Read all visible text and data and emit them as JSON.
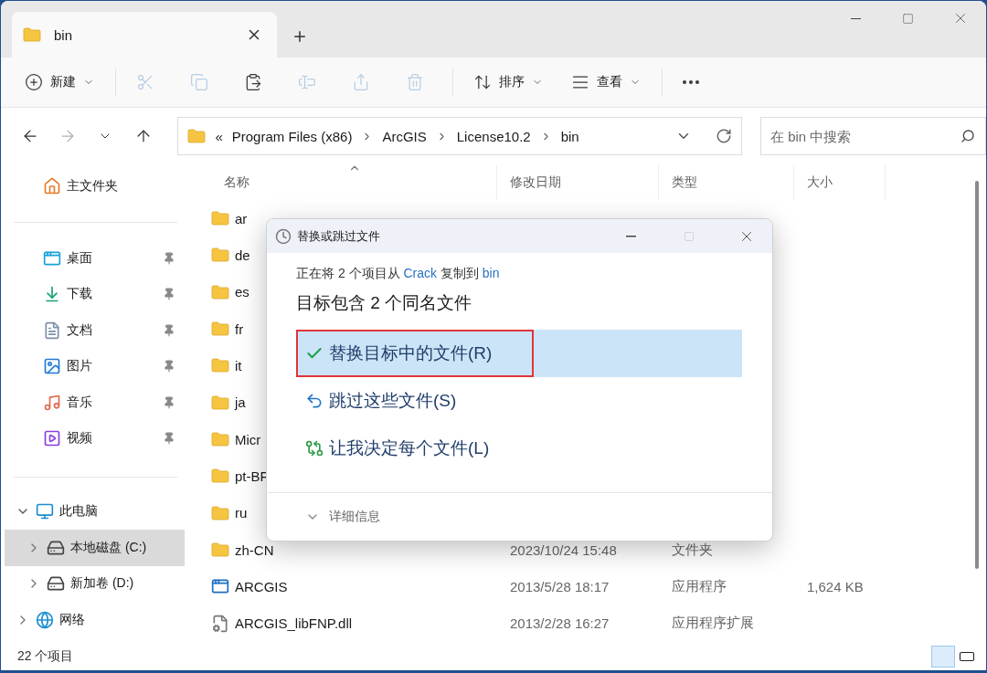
{
  "tabs": [
    {
      "title": "bin",
      "selected": true
    }
  ],
  "toolbar": [
    {
      "label": "新建",
      "disabled": false
    },
    {
      "disabled": true
    },
    {
      "disabled": true
    },
    {
      "disabled": false
    },
    {
      "disabled": true
    },
    {
      "disabled": true
    },
    {
      "disabled": true
    },
    {
      "label": "排序",
      "disabled": false
    },
    {
      "label": "查看",
      "disabled": false
    },
    {
      "disabled": false
    }
  ],
  "nav": [
    {
      "disabled": false
    },
    {
      "disabled": true
    },
    {
      "disabled": false
    },
    {
      "disabled": false
    }
  ],
  "address": {
    "overflow": "«",
    "segments": [
      "Program Files (x86)",
      "ArcGIS",
      "License10.2",
      "bin"
    ]
  },
  "search": {
    "placeholder": "在 bin 中搜索"
  },
  "sidebar": {
    "home": "主文件夹",
    "quick": [
      {
        "label": "桌面",
        "pinned": true
      },
      {
        "label": "下载",
        "pinned": true
      },
      {
        "label": "文档",
        "pinned": true
      },
      {
        "label": "图片",
        "pinned": true
      },
      {
        "label": "音乐",
        "pinned": true
      },
      {
        "label": "视频",
        "pinned": true
      }
    ],
    "tree": [
      {
        "label": "此电脑",
        "expanded": true,
        "selected": false,
        "children": [
          {
            "label": "本地磁盘 (C:)",
            "expanded": false,
            "selected": true
          },
          {
            "label": "新加卷 (D:)",
            "expanded": false,
            "selected": false
          }
        ]
      },
      {
        "label": "网络",
        "expanded": false,
        "selected": false
      }
    ]
  },
  "columns": [
    {
      "label": "名称",
      "sorted": true
    },
    {
      "label": "修改日期",
      "sorted": false
    },
    {
      "label": "类型",
      "sorted": false
    },
    {
      "label": "大小",
      "sorted": false
    }
  ],
  "rows": [
    {
      "kind": "folder",
      "name": "ar"
    },
    {
      "kind": "folder",
      "name": "de"
    },
    {
      "kind": "folder",
      "name": "es"
    },
    {
      "kind": "folder",
      "name": "fr"
    },
    {
      "kind": "folder",
      "name": "it"
    },
    {
      "kind": "folder",
      "name": "ja"
    },
    {
      "kind": "folder",
      "name": "Micr"
    },
    {
      "kind": "folder",
      "name": "pt-BF"
    },
    {
      "kind": "folder",
      "name": "ru"
    },
    {
      "kind": "folder",
      "name": "zh-CN",
      "date": "2023/10/24 15:48",
      "type": "文件夹"
    },
    {
      "kind": "app",
      "name": "ARCGIS",
      "date": "2013/5/28 18:17",
      "type": "应用程序",
      "size": "1,624 KB"
    },
    {
      "kind": "dll",
      "name": "ARCGIS_libFNP.dll",
      "date": "2013/2/28 16:27",
      "type": "应用程序扩展"
    }
  ],
  "status_bar": {
    "count": "22 个项目"
  },
  "view_buttons": [
    {
      "selected": true
    },
    {
      "selected": false
    }
  ],
  "dialog": {
    "title": "替换或跳过文件",
    "message": [
      {
        "text": "正在将 2 个项目从 ",
        "link": false
      },
      {
        "text": "Crack",
        "link": true
      },
      {
        "text": " 复制到 ",
        "link": false
      },
      {
        "text": "bin",
        "link": true
      }
    ],
    "heading": "目标包含 2 个同名文件",
    "options": [
      {
        "kind": "replace",
        "label": "替换目标中的文件(R)",
        "selected": true,
        "marked": true
      },
      {
        "kind": "skip",
        "label": "跳过这些文件(S)",
        "selected": false,
        "marked": false
      },
      {
        "kind": "decide",
        "label": "让我决定每个文件(L)",
        "selected": false,
        "marked": false
      }
    ],
    "details": {
      "label": "详细信息",
      "expanded": false
    }
  }
}
